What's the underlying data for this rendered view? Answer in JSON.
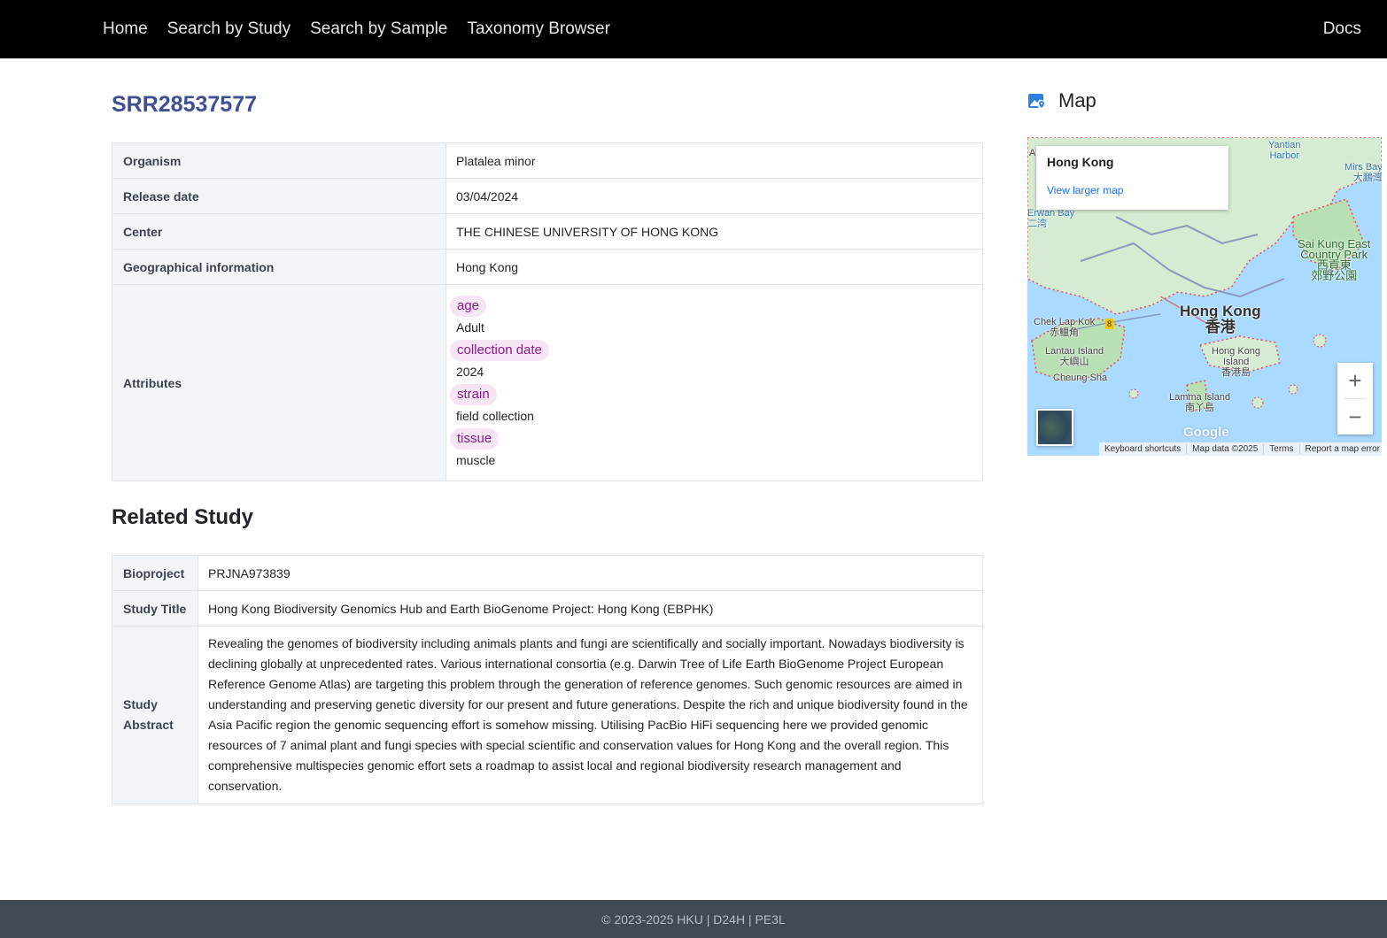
{
  "nav": {
    "links": [
      "Home",
      "Search by Study",
      "Search by Sample",
      "Taxonomy Browser"
    ],
    "docs": "Docs"
  },
  "sample": {
    "title": "SRR28537577",
    "rows": [
      {
        "label": "Organism",
        "value": "Platalea minor"
      },
      {
        "label": "Release date",
        "value": "03/04/2024"
      },
      {
        "label": "Center",
        "value": "THE CHINESE UNIVERSITY OF HONG KONG"
      },
      {
        "label": "Geographical information",
        "value": "Hong Kong"
      }
    ],
    "attributes_label": "Attributes",
    "attributes": [
      {
        "key": "age",
        "value": "Adult"
      },
      {
        "key": "collection date",
        "value": "2024"
      },
      {
        "key": "strain",
        "value": "field collection"
      },
      {
        "key": "tissue",
        "value": "muscle"
      }
    ]
  },
  "related": {
    "heading": "Related Study",
    "rows": [
      {
        "label": "Bioproject",
        "value": "PRJNA973839"
      },
      {
        "label": "Study Title",
        "value": "Hong Kong Biodiversity Genomics Hub and Earth BioGenome Project: Hong Kong (EBPHK)"
      },
      {
        "label": "Study Abstract",
        "value": "Revealing the genomes of biodiversity including animals plants and fungi are scientifically and socially important. Nowadays biodiversity is declining globally at unprecedented rates. Various international consortia (e.g. Darwin Tree of Life Earth BioGenome Project European Reference Genome Atlas) are targeting this problem through the generation of reference genomes. Such genomic resources are aimed in understanding and preserving genetic diversity for our present and future generations. Despite the rich and unique biodiversity found in the Asia Pacific region the genomic sequencing effort is somehow missing. Utilising PacBio HiFi sequencing here we provided genomic resources of 7 animal plant and fungi species with special scientific and conservation values for Hong Kong and the overall region. This comprehensive multispecies genomic effort sets a roadmap to assist local and regional biodiversity research management and conservation."
      }
    ]
  },
  "map": {
    "heading": "Map",
    "icon": "map-pin-icon",
    "card_place": "Hong Kong",
    "card_link": "View larger map",
    "labels": {
      "yantian": "Yantian\nHarbor",
      "mirs": "Mirs Bay\n大鵬灣",
      "erwan": "Erwan Bay\n二湾",
      "saikung": "Sai Kung East\nCountry Park\n西貢東\n郊野公園",
      "hk_big": "Hong Kong\n香港",
      "cheklapkok": "Chek Lap Kok\n赤鱲角",
      "lantau": "Lantau Island\n大嶼山",
      "cheungsha": "Cheung Sha",
      "hkisland": "Hong Kong\nIsland\n香港島",
      "lamma": "Lamma Island\n南丫島",
      "route": "8",
      "corner": "A"
    },
    "google": "Google",
    "footer": [
      "Keyboard shortcuts",
      "Map data ©2025",
      "Terms",
      "Report a map error"
    ],
    "zoom_in": "+",
    "zoom_out": "−",
    "colors": {
      "water": "#aadaff",
      "land": "#d6ecd2",
      "park": "#b9dfb5",
      "road": "#8899bb",
      "accent": "#3f4f94"
    }
  },
  "footer": "© 2023-2025 HKU | D24H | PE3L"
}
